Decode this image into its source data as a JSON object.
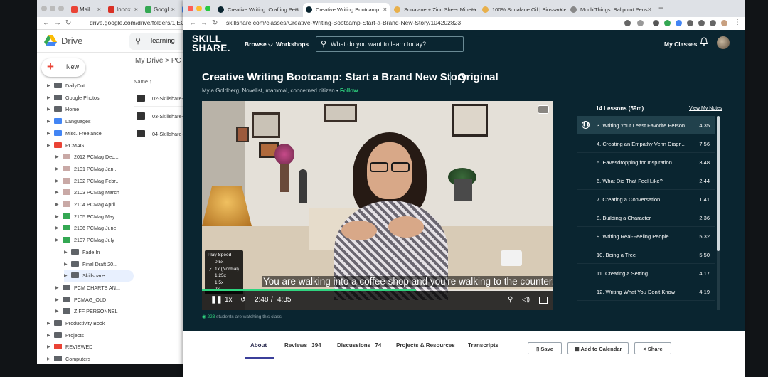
{
  "drive_window": {
    "tabs": [
      {
        "label": "Mail",
        "color": "#ea4335"
      },
      {
        "label": "Inbox",
        "color": "#d93025"
      },
      {
        "label": "Googl",
        "color": "#34a853"
      },
      {
        "label": "G",
        "color": "#4285f4"
      }
    ],
    "url": "drive.google.com/drive/folders/1jECgN",
    "app_name": "Drive",
    "search_value": "learning",
    "new_label": "New",
    "breadcrumb": "My Drive  >  PC",
    "name_column": "Name ↑",
    "tree": [
      {
        "name": "DailyDot",
        "color": "#5f6368",
        "level": 0
      },
      {
        "name": "Google Photos",
        "color": "#5f6368",
        "level": 0
      },
      {
        "name": "Home",
        "color": "#5f6368",
        "level": 0
      },
      {
        "name": "Languages",
        "color": "#4285f4",
        "level": 0
      },
      {
        "name": "Misc. Freelance",
        "color": "#4285f4",
        "level": 0
      },
      {
        "name": "PCMAG",
        "color": "#ea4335",
        "level": 0
      },
      {
        "name": "2012 PCMag Dec...",
        "color": "#c9a9a6",
        "level": 1
      },
      {
        "name": "2101 PCMag Jan...",
        "color": "#c9a9a6",
        "level": 1
      },
      {
        "name": "2102 PCMag Febr...",
        "color": "#c9a9a6",
        "level": 1
      },
      {
        "name": "2103 PCMag March",
        "color": "#c9a9a6",
        "level": 1
      },
      {
        "name": "2104 PCMag April",
        "color": "#c9a9a6",
        "level": 1
      },
      {
        "name": "2105 PCMag May",
        "color": "#34a853",
        "level": 1
      },
      {
        "name": "2106 PCMag June",
        "color": "#34a853",
        "level": 1
      },
      {
        "name": "2107 PCMag July",
        "color": "#34a853",
        "level": 1
      },
      {
        "name": "Fade In",
        "color": "#5f6368",
        "level": 2
      },
      {
        "name": "Final Draft 20...",
        "color": "#5f6368",
        "level": 2
      },
      {
        "name": "Skillshare",
        "color": "#5f6368",
        "level": 2,
        "selected": true
      },
      {
        "name": "PCM CHARTS AN...",
        "color": "#5f6368",
        "level": 1
      },
      {
        "name": "PCMAG_OLD",
        "color": "#5f6368",
        "level": 1
      },
      {
        "name": "ZIFF PERSONNEL",
        "color": "#5f6368",
        "level": 1
      },
      {
        "name": "Productivity Book",
        "color": "#5f6368",
        "level": 0
      },
      {
        "name": "Projects",
        "color": "#5f6368",
        "level": 0
      },
      {
        "name": "REVIEWED",
        "color": "#ea4335",
        "level": 0
      },
      {
        "name": "Computers",
        "color": "#5f6368",
        "level": 0
      }
    ],
    "files": [
      "02-Skillshare-",
      "03-Skillshare-",
      "04-Skillshare-"
    ]
  },
  "browser": {
    "tabs": [
      {
        "label": "Creative Writing: Crafting Pers",
        "color": "#0a2530",
        "active": false
      },
      {
        "label": "Creative Writing Bootcamp",
        "color": "#0a2530",
        "active": true
      },
      {
        "label": "Squalane + Zinc Sheer Minera",
        "color": "#e8b04b",
        "active": false
      },
      {
        "label": "100% Squalane Oil | Biossance",
        "color": "#e8b04b",
        "active": false
      },
      {
        "label": "MochiThings: Ballpoint Pens",
        "color": "#888888",
        "active": false
      }
    ],
    "url": "skillshare.com/classes/Creative-Writing-Bootcamp-Start-a-Brand-New-Story/104202823"
  },
  "nav": {
    "logo_line1": "SKILL",
    "logo_line2": "SHARE.",
    "browse": "Browse ⌵",
    "workshops": "Workshops",
    "search_placeholder": "What do you want to learn today?",
    "my_classes": "My Classes",
    "bell_icon": "🔔"
  },
  "class": {
    "title": "Creative Writing Bootcamp: Start a Brand New Story",
    "badge": "Original",
    "teacher": "Myla Goldberg, Novelist, mammal, concerned citizen",
    "follow": "Follow"
  },
  "video": {
    "caption": "You are walking into a coffee shop and you're walking to the counter.",
    "time_current": "2:48",
    "time_total": "4:35",
    "progress": 0.61,
    "speed_button": "1x",
    "speed_menu_title": "Play Speed",
    "speed_options": [
      "0.5x",
      "1x (Normal)",
      "1.25x",
      "1.5x",
      "2x"
    ],
    "speed_selected": "1x (Normal)",
    "watching_count": "223",
    "watching_text": "students are watching this class"
  },
  "lessons": {
    "header": "14 Lessons (59m)",
    "notes_link": "View My Notes",
    "items": [
      {
        "title": "3. Writing Your Least Favorite Person",
        "duration": "4:35",
        "current": true
      },
      {
        "title": "4. Creating an Empathy Venn Diagr...",
        "duration": "7:56"
      },
      {
        "title": "5. Eavesdropping for Inspiration",
        "duration": "3:48"
      },
      {
        "title": "6. What Did That Feel Like?",
        "duration": "2:44"
      },
      {
        "title": "7. Creating a Conversation",
        "duration": "1:41"
      },
      {
        "title": "8. Building a Character",
        "duration": "2:36"
      },
      {
        "title": "9. Writing Real-Feeling People",
        "duration": "5:32"
      },
      {
        "title": "10. Being a Tree",
        "duration": "5:50"
      },
      {
        "title": "11. Creating a Setting",
        "duration": "4:17"
      },
      {
        "title": "12. Writing What You Don't Know",
        "duration": "4:19"
      }
    ]
  },
  "bottom_tabs": {
    "about": "About",
    "reviews": "Reviews",
    "reviews_count": "394",
    "discussions": "Discussions",
    "discussions_count": "74",
    "projects": "Projects & Resources",
    "transcripts": "Transcripts",
    "save": "Save",
    "calendar": "Add to Calendar",
    "share": "Share"
  }
}
